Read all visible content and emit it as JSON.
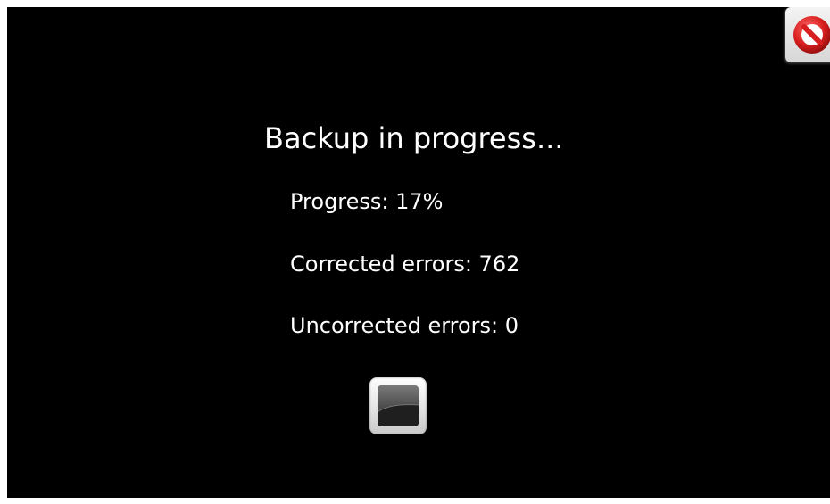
{
  "dialog": {
    "title": "Backup in progress...",
    "progress_label": "Progress: 17%",
    "corrected_errors_label": "Corrected errors: 762",
    "uncorrected_errors_label": "Uncorrected errors: 0"
  },
  "status": {
    "progress_percent": 17,
    "corrected_errors": 762,
    "uncorrected_errors": 0
  },
  "buttons": {
    "stop": {
      "icon": "stop-icon"
    },
    "cancel": {
      "icon": "no-entry-icon"
    }
  },
  "colors": {
    "background": "#000000",
    "text": "#ffffff",
    "cancel_red": "#d81e1e"
  }
}
